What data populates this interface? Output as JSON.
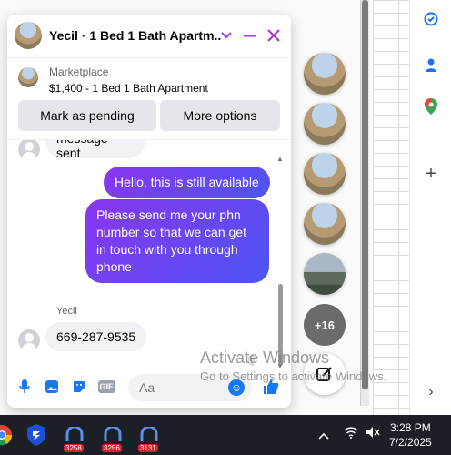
{
  "chat": {
    "title": "Yecil · 1 Bed 1 Bath Apartm...",
    "marketplace_label": "Marketplace",
    "listing": "$1,400 - 1 Bed 1 Bath Apartment",
    "buttons": {
      "mark_pending": "Mark as pending",
      "more_options": "More options"
    },
    "messages": [
      {
        "direction": "in",
        "text": "message sent"
      },
      {
        "direction": "out",
        "text": "Hello, this is still available"
      },
      {
        "direction": "out",
        "text": "Please send me your phn number so that we can get in touch with you through phone"
      },
      {
        "direction": "in",
        "sender": "Yecil",
        "text": "669-287-9535"
      }
    ],
    "composer_placeholder": "Aa"
  },
  "chat_heads": {
    "more_count": "+16"
  },
  "watermark": {
    "line1": "Activate Windows",
    "line2": "Go to Settings to activate Windows."
  },
  "taskbar": {
    "badges": [
      "3258",
      "3256",
      "3131"
    ],
    "time": "3:28 PM",
    "date": "7/2/2025"
  },
  "colors": {
    "accent": "#a43bd6",
    "bubble_start": "#8a36ef",
    "bubble_end": "#4c54f2",
    "messenger_blue": "#1877f2"
  }
}
